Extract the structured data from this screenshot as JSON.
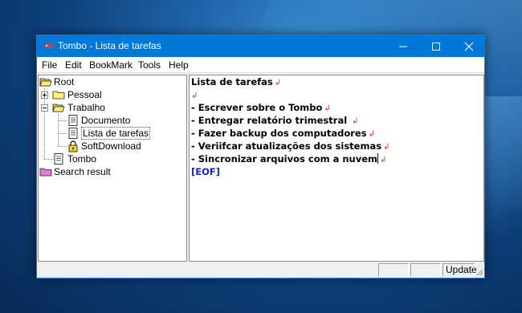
{
  "window": {
    "title": "Tombo - Lista de tarefas",
    "accent": "#0078d7"
  },
  "menu": [
    "File",
    "Edit",
    "BookMark",
    "Tools",
    "Help"
  ],
  "tree": [
    {
      "label": "Root",
      "icon": "folder-open-icon"
    },
    {
      "label": "Pessoal",
      "icon": "folder-icon"
    },
    {
      "label": "Trabalho",
      "icon": "folder-open-icon"
    },
    {
      "label": "Documento",
      "icon": "document-icon"
    },
    {
      "label": "Lista de tarefas",
      "icon": "document-icon",
      "selected": true
    },
    {
      "label": "SoftDownload",
      "icon": "lock-icon"
    },
    {
      "label": "Tombo",
      "icon": "document-icon"
    },
    {
      "label": "Search result",
      "icon": "folder-pink-icon"
    }
  ],
  "editor": {
    "lines": [
      "Lista de tarefas",
      "",
      "- Escrever sobre o Tombo",
      "- Entregar relatório trimestral ",
      "- Fazer backup dos computadores",
      "- Veriifcar atualizações dos sistemas",
      "- Sincronizar arquivos com a nuvem"
    ],
    "eof": "[EOF]"
  },
  "status": {
    "update_label": "Update"
  }
}
